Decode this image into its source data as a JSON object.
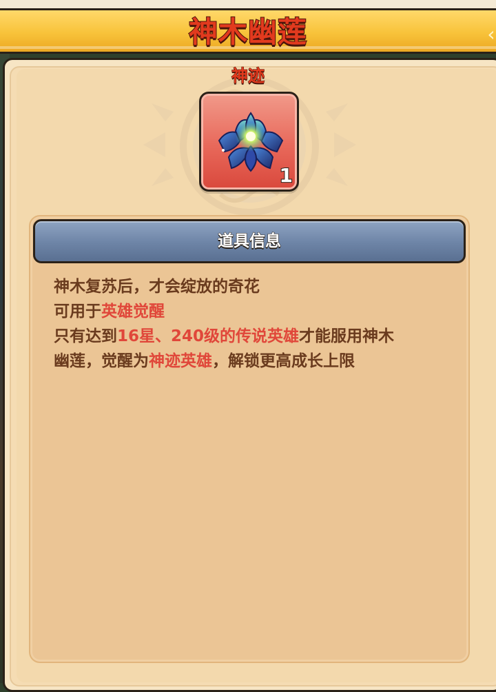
{
  "title": "神木幽莲",
  "rarity": "神迹",
  "item": {
    "icon": "lotus-icon",
    "count": "1",
    "tile_color": "#e8685a"
  },
  "info": {
    "header": "道具信息",
    "lines": [
      [
        {
          "t": "神木复苏后，才会绽放的奇花",
          "hl": false
        }
      ],
      [
        {
          "t": "可用于",
          "hl": false
        },
        {
          "t": "英雄觉醒",
          "hl": true
        }
      ],
      [
        {
          "t": "只有达到",
          "hl": false
        },
        {
          "t": "16星、240级的传说英雄",
          "hl": true
        },
        {
          "t": "才能服用神木",
          "hl": false
        }
      ],
      [
        {
          "t": "幽莲，觉醒为",
          "hl": false
        },
        {
          "t": "神迹英雄",
          "hl": true
        },
        {
          "t": "，解锁更高成长上限",
          "hl": false
        }
      ]
    ]
  },
  "colors": {
    "title": "#e23a1e",
    "banner": "#f8c33a",
    "highlight": "#e0473a",
    "body_text": "#6a3b1e",
    "header_bar": "#6d84a6"
  }
}
